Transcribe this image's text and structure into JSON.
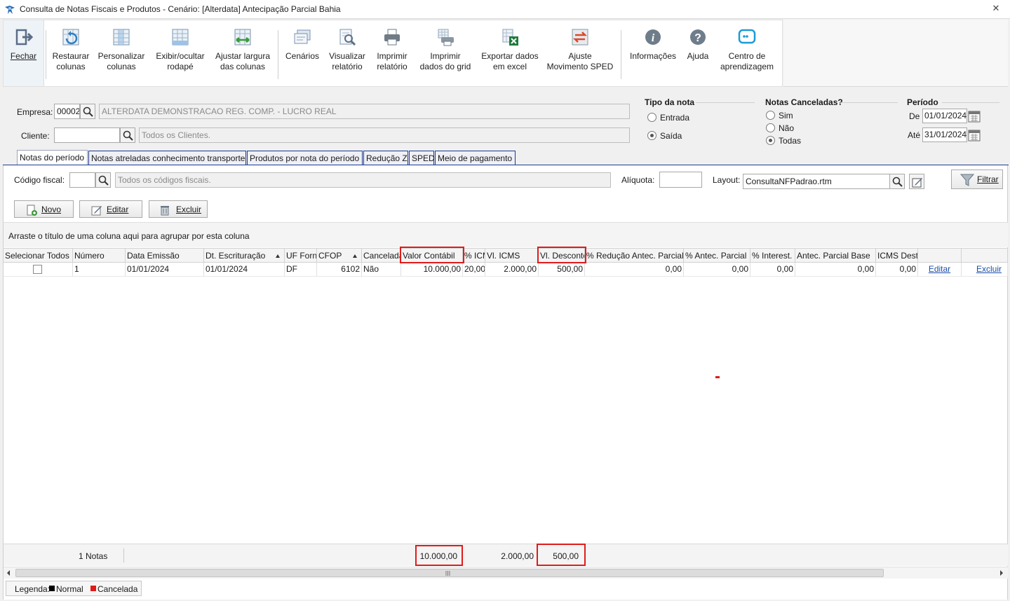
{
  "window": {
    "title": "Consulta de Notas Fiscais e Produtos - Cenário: [Alterdata] Antecipação Parcial Bahia",
    "close_glyph": "✕"
  },
  "toolbar": {
    "fechar": "Fechar",
    "restaurar_l1": "Restaurar",
    "restaurar_l2": "colunas",
    "personalizar_l1": "Personalizar",
    "personalizar_l2": "colunas",
    "exibir_l1": "Exibir/ocultar",
    "exibir_l2": "rodapé",
    "ajustar_l1": "Ajustar largura",
    "ajustar_l2": "das colunas",
    "cenarios": "Cenários",
    "visualizar_l1": "Visualizar",
    "visualizar_l2": "relatório",
    "imprimir_rel_l1": "Imprimir",
    "imprimir_rel_l2": "relatório",
    "imprimir_grid_l1": "Imprimir",
    "imprimir_grid_l2": "dados do grid",
    "exportar_l1": "Exportar dados",
    "exportar_l2": "em excel",
    "ajuste_sped_l1": "Ajuste",
    "ajuste_sped_l2": "Movimento SPED",
    "informacoes": "Informações",
    "ajuda": "Ajuda",
    "centro_l1": "Centro de",
    "centro_l2": "aprendizagem"
  },
  "filters": {
    "empresa_label": "Empresa:",
    "empresa_code": "00002",
    "empresa_name": "ALTERDATA DEMONSTRACAO REG. COMP. - LUCRO REAL",
    "cliente_label": "Cliente:",
    "cliente_code": "",
    "cliente_name": "Todos os Clientes.",
    "tipo_nota_title": "Tipo da nota",
    "tipo_entrada": "Entrada",
    "tipo_saida": "Saída",
    "canceladas_title": "Notas Canceladas?",
    "canc_sim": "Sim",
    "canc_nao": "Não",
    "canc_todas": "Todas",
    "periodo_title": "Período",
    "de_label": "De",
    "de_value": "01/01/2024",
    "ate_label": "Até",
    "ate_value": "31/01/2024"
  },
  "tabs": [
    "Notas do período",
    "Notas atreladas conhecimento transporte",
    "Produtos por nota do período",
    "Redução Z",
    "SPED",
    "Meio de pagamento"
  ],
  "subfilters": {
    "codigo_fiscal_label": "Código fiscal:",
    "codigo_fiscal_value": "",
    "codigo_fiscal_desc": "Todos os códigos fiscais.",
    "aliquota_label": "Alíquota:",
    "aliquota_value": "",
    "layout_label": "Layout:",
    "layout_value": "ConsultaNFPadrao.rtm",
    "filtrar": "Filtrar"
  },
  "actions": {
    "novo": "Novo",
    "editar": "Editar",
    "excluir": "Excluir"
  },
  "grid": {
    "group_hint": "Arraste o título de uma coluna aqui para agrupar por esta coluna",
    "headers": {
      "sel": "Selecionar Todos",
      "numero": "Número",
      "data_emissao": "Data Emissão",
      "dt_escrituracao": "Dt. Escrituração",
      "uf": "UF Forn",
      "cfop": "CFOP",
      "cancelada": "Cancelada",
      "valor_contabil": "Valor Contábil",
      "pct_icms": "% ICMS",
      "vl_icms": "Vl. ICMS",
      "vl_desconto": "Vl. Desconto",
      "pct_red": "% Redução Antec. Parcial",
      "pct_antec": "% Antec. Parcial",
      "pct_interest": "% Interest.",
      "antec_base": "Antec. Parcial Base",
      "icms_dest": "ICMS Destacado"
    },
    "row": {
      "numero": "1",
      "data_emissao": "01/01/2024",
      "dt_escrituracao": "01/01/2024",
      "uf": "DF",
      "cfop": "6102",
      "cancelada": "Não",
      "valor_contabil": "10.000,00",
      "pct_icms": "20,00",
      "vl_icms": "2.000,00",
      "vl_desconto": "500,00",
      "pct_red": "0,00",
      "pct_antec": "0,00",
      "pct_interest": "0,00",
      "antec_base": "0,00",
      "icms_dest": "0,00",
      "editar": "Editar",
      "excluir": "Excluir"
    },
    "footer": {
      "count": "1 Notas",
      "valor_contabil": "10.000,00",
      "vl_icms": "2.000,00",
      "vl_desconto": "500,00"
    }
  },
  "legend": {
    "label": "Legenda:",
    "normal": "Normal",
    "cancelada": "Cancelada",
    "normal_color": "#000000",
    "cancelada_color": "#e01b1b"
  }
}
